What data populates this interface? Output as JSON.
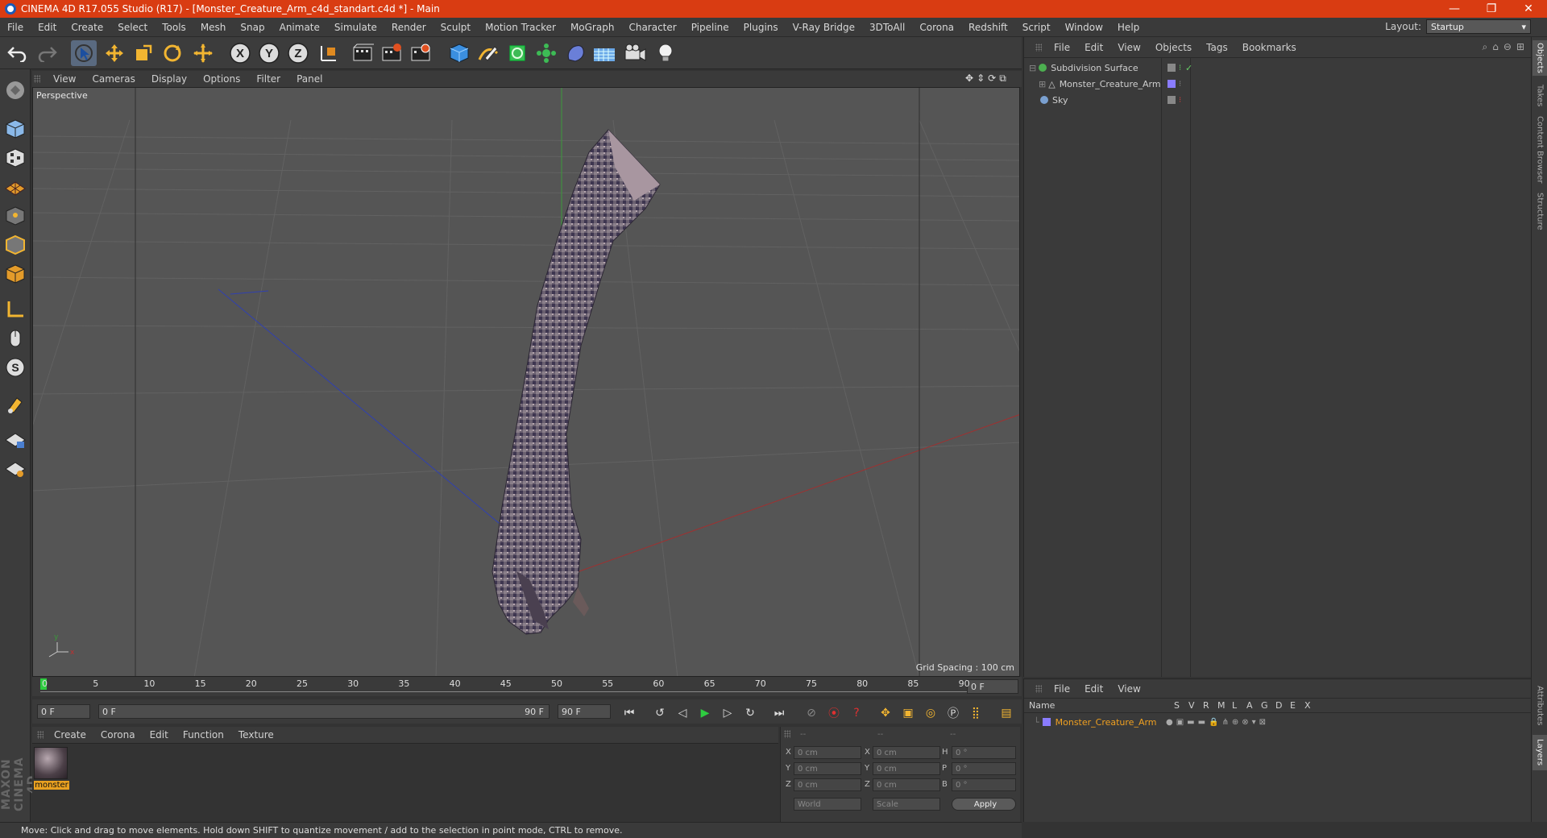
{
  "window": {
    "title": "CINEMA 4D R17.055 Studio (R17) - [Monster_Creature_Arm_c4d_standart.c4d *] - Main",
    "minimize": "—",
    "maximize": "❐",
    "close": "✕"
  },
  "menu": [
    "File",
    "Edit",
    "Create",
    "Select",
    "Tools",
    "Mesh",
    "Snap",
    "Animate",
    "Simulate",
    "Render",
    "Sculpt",
    "Motion Tracker",
    "MoGraph",
    "Character",
    "Pipeline",
    "Plugins",
    "V-Ray Bridge",
    "3DToAll",
    "Corona",
    "Redshift",
    "Script",
    "Window",
    "Help"
  ],
  "layout": {
    "label": "Layout:",
    "value": "Startup"
  },
  "toolbar": {
    "icons": [
      "undo-icon",
      "redo-icon",
      "select-arrow-icon",
      "move-icon",
      "scale-icon",
      "rotate-icon",
      "move-plus-icon",
      "x-axis-icon",
      "y-axis-icon",
      "z-axis-icon",
      "coordinate-system-icon",
      "render-view-icon",
      "render-picture-viewer-icon",
      "render-settings-icon",
      "cube-primitive-icon",
      "pen-spline-icon",
      "subdivision-icon",
      "array-icon",
      "deformer-icon",
      "floor-icon",
      "camera-icon",
      "light-icon"
    ],
    "axis_labels": [
      "X",
      "Y",
      "Z"
    ]
  },
  "viewport": {
    "menu": [
      "View",
      "Cameras",
      "Display",
      "Options",
      "Filter",
      "Panel"
    ],
    "label": "Perspective",
    "grid_spacing": "Grid Spacing : 100 cm"
  },
  "timeline": {
    "ticks": [
      "0",
      "5",
      "10",
      "15",
      "20",
      "25",
      "30",
      "35",
      "40",
      "45",
      "50",
      "55",
      "60",
      "65",
      "70",
      "75",
      "80",
      "85",
      "90"
    ],
    "current_frame": "0 F",
    "start_field": "0 F",
    "range_start": "0 F",
    "range_end": "90 F",
    "end_field": "90 F"
  },
  "material_manager": {
    "menu": [
      "Create",
      "Corona",
      "Edit",
      "Function",
      "Texture"
    ],
    "materials": [
      {
        "name": "monster"
      }
    ]
  },
  "coordinates": {
    "headers": [
      "--",
      "--",
      "--"
    ],
    "rows": [
      {
        "pos_label": "X",
        "pos": "0 cm",
        "size_label": "X",
        "size": "0 cm",
        "rot_label": "H",
        "rot": "0 °"
      },
      {
        "pos_label": "Y",
        "pos": "0 cm",
        "size_label": "Y",
        "size": "0 cm",
        "rot_label": "P",
        "rot": "0 °"
      },
      {
        "pos_label": "Z",
        "pos": "0 cm",
        "size_label": "Z",
        "size": "0 cm",
        "rot_label": "B",
        "rot": "0 °"
      }
    ],
    "mode": "World",
    "size_mode": "Scale",
    "apply": "Apply"
  },
  "status": "Move: Click and drag to move elements. Hold down SHIFT to quantize movement / add to the selection in point mode, CTRL to remove.",
  "object_manager": {
    "menu": [
      "File",
      "Edit",
      "View",
      "Objects",
      "Tags",
      "Bookmarks"
    ],
    "objects": [
      {
        "name": "Subdivision Surface",
        "icon_color": "#4caf50",
        "indent": 0
      },
      {
        "name": "Monster_Creature_Arm",
        "icon_color": "#d0d0d0",
        "indent": 1
      },
      {
        "name": "Sky",
        "icon_color": "#7aa0d0",
        "indent": 0
      }
    ]
  },
  "layer_manager": {
    "menu": [
      "File",
      "Edit",
      "View"
    ],
    "columns": [
      "Name",
      "S",
      "V",
      "R",
      "M",
      "L",
      "A",
      "G",
      "D",
      "E",
      "X"
    ],
    "layers": [
      {
        "name": "Monster_Creature_Arm",
        "color": "#8a7cff"
      }
    ]
  },
  "side_tabs": [
    "Objects",
    "Takes",
    "Content Browser",
    "Structure"
  ],
  "side_tabs_bottom": [
    "Attributes",
    "Layers"
  ],
  "brand": "MAXON CINEMA 4D",
  "colors": {
    "title_bar": "#d93c12",
    "selected_text": "#f0a020",
    "accent_blue": "#5a6a80"
  }
}
